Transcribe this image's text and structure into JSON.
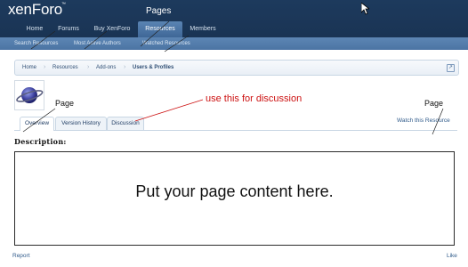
{
  "header": {
    "logo_text": "xenForo",
    "logo_mark": "™",
    "annotation_pages": "Pages"
  },
  "nav": {
    "tabs": [
      {
        "label": "Home"
      },
      {
        "label": "Forums"
      },
      {
        "label": "Buy XenForo"
      },
      {
        "label": "Resources"
      },
      {
        "label": "Members"
      }
    ],
    "active_tab": "Resources",
    "sub_items": [
      {
        "label": "Search Resources"
      },
      {
        "label": "Most Active Authors"
      },
      {
        "label": "Watched Resources"
      }
    ]
  },
  "breadcrumb": {
    "items": [
      {
        "label": "Home"
      },
      {
        "label": "Resources"
      },
      {
        "label": "Add-ons"
      },
      {
        "label": "Users & Profiles"
      }
    ],
    "jump_icon": "↗"
  },
  "resource": {
    "icon": "planet-icon",
    "page_label_left": "Page",
    "page_label_right": "Page",
    "annotation_discussion": "use this for discussion"
  },
  "tabs": [
    {
      "label": "Overview"
    },
    {
      "label": "Version History"
    },
    {
      "label": "Discussion"
    }
  ],
  "active_resource_tab": "Overview",
  "watch_link": "Watch this Resource",
  "description_label": "Description:",
  "content_text": "Put your page content here.",
  "footer": {
    "report": "Report",
    "like": "Like"
  },
  "colors": {
    "header_bg": "#1d3a5d",
    "subnav_bg": "#5d86b4",
    "annotation_red": "#cc1111",
    "link": "#2f5a8a"
  }
}
